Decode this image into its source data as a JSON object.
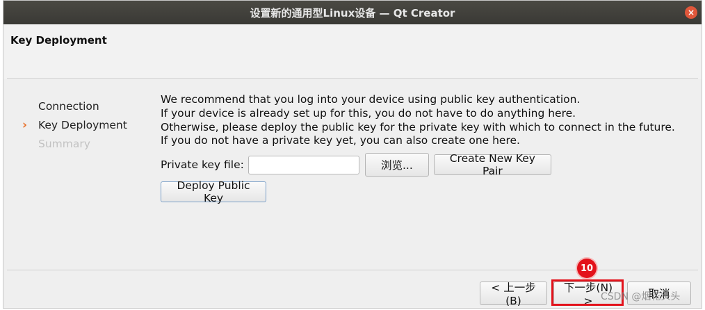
{
  "window": {
    "title": "设置新的通用型Linux设备 — Qt Creator",
    "close_glyph": "×"
  },
  "header": {
    "title": "Key Deployment"
  },
  "sidebar": {
    "marker_glyph": "›",
    "items": [
      {
        "label": "Connection",
        "state": "done"
      },
      {
        "label": "Key Deployment",
        "state": "current"
      },
      {
        "label": "Summary",
        "state": "disabled"
      }
    ]
  },
  "content": {
    "paragraph": [
      "We recommend that you log into your device using public key authentication.",
      "If your device is already set up for this, you do not have to do anything here.",
      "Otherwise, please deploy the public key for the private key with which to connect in the future.",
      "If you do not have a private key yet, you can also create one here."
    ],
    "private_key_label": "Private key file:",
    "private_key_value": "",
    "browse_label": "浏览...",
    "new_key_label": "Create New Key Pair",
    "deploy_label": "Deploy Public Key"
  },
  "footer": {
    "back_label": "< 上一步(B)",
    "next_label": "下一步(N) >",
    "cancel_label": "取消"
  },
  "annotation": {
    "badge": "10",
    "color": "#e3121b"
  },
  "watermark": "CSDN @烟花头头"
}
